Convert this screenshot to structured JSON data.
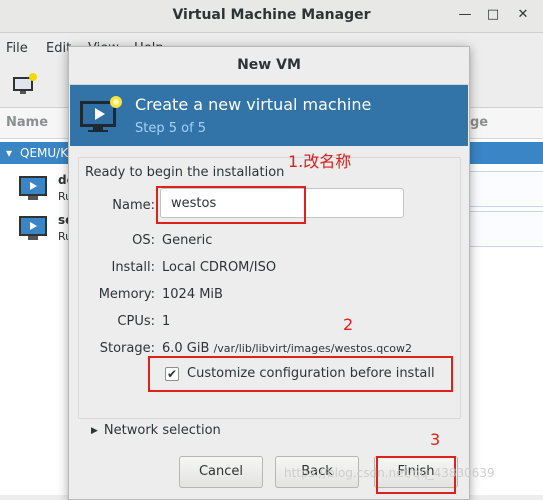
{
  "main_window": {
    "title": "Virtual Machine Manager",
    "menu": [
      "File",
      "Edit",
      "View",
      "Help"
    ],
    "columns": {
      "name": "Name",
      "usage": "ge"
    },
    "connection_label": "QEMU/K",
    "vms": [
      {
        "name": "de",
        "state": "Ru"
      },
      {
        "name": "se",
        "state": "Ru"
      }
    ]
  },
  "dialog": {
    "title": "New VM",
    "banner_title": "Create a new virtual machine",
    "banner_step": "Step 5 of 5",
    "ready_text": "Ready to begin the installation",
    "fields": {
      "name_label": "Name:",
      "name_value": "westos",
      "os_label": "OS:",
      "os_value": "Generic",
      "install_label": "Install:",
      "install_value": "Local CDROM/ISO",
      "memory_label": "Memory:",
      "memory_value": "1024 MiB",
      "cpus_label": "CPUs:",
      "cpus_value": "1",
      "storage_label": "Storage:",
      "storage_size": "6.0 GiB",
      "storage_path": "/var/lib/libvirt/images/westos.qcow2"
    },
    "customize_label": "Customize configuration before install",
    "customize_checked": true,
    "network_label": "Network selection",
    "buttons": {
      "cancel": "Cancel",
      "back": "Back",
      "finish": "Finish"
    }
  },
  "annotations": {
    "step1": "1.改名称",
    "step2": "2",
    "step3": "3"
  },
  "watermark": "https://blog.csdn.net/qq_43830639",
  "colors": {
    "banner": "#3273a8",
    "annotation": "#e0201b",
    "selection": "#3a85c6"
  }
}
